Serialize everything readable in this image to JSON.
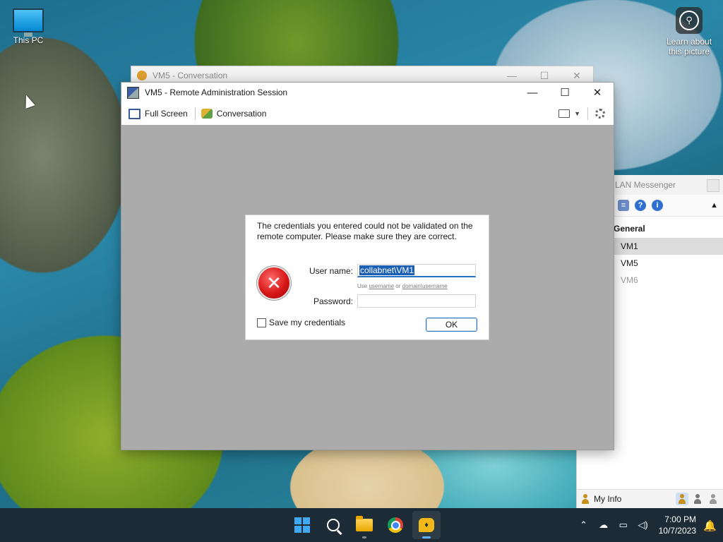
{
  "desktop": {
    "icons": [
      {
        "label": "This PC"
      },
      {
        "label": "Learn about this picture"
      }
    ]
  },
  "conversation_window": {
    "title": "VM5 - Conversation",
    "controls": {
      "minimize": "—",
      "maximize": "☐",
      "close": "✕"
    }
  },
  "lan_messenger": {
    "title": "LAN Messenger",
    "group": "General",
    "contacts": [
      {
        "name": "VM1",
        "selected": true,
        "online": true
      },
      {
        "name": "VM5",
        "selected": false,
        "online": true
      },
      {
        "name": "VM6",
        "selected": false,
        "online": false
      }
    ],
    "my_info": "My Info"
  },
  "remote_session": {
    "title": "VM5 - Remote Administration Session",
    "controls": {
      "minimize": "—",
      "maximize": "☐",
      "close": "✕"
    },
    "toolbar": {
      "full_screen": "Full Screen",
      "conversation": "Conversation"
    }
  },
  "login_dialog": {
    "message": "The credentials you entered could not be validated on the remote computer. Please make sure they are correct.",
    "user_label": "User name:",
    "user_value": "collabnet\\VM1",
    "hint_use": "Use",
    "hint_username": "username",
    "hint_or": "or",
    "hint_domain_username": "domain\\username",
    "password_label": "Password:",
    "password_value": "",
    "save_credentials": "Save my credentials",
    "save_checked": false,
    "ok": "OK"
  },
  "taskbar": {
    "apps": [
      {
        "name": "start",
        "icon": "windows-logo"
      },
      {
        "name": "search",
        "icon": "search-icon"
      },
      {
        "name": "file-explorer",
        "icon": "folder-icon"
      },
      {
        "name": "chrome",
        "icon": "chrome-icon"
      },
      {
        "name": "lan-messenger",
        "icon": "lan-messenger-icon",
        "active": true
      }
    ],
    "time": "7:00 PM",
    "date": "10/7/2023"
  }
}
